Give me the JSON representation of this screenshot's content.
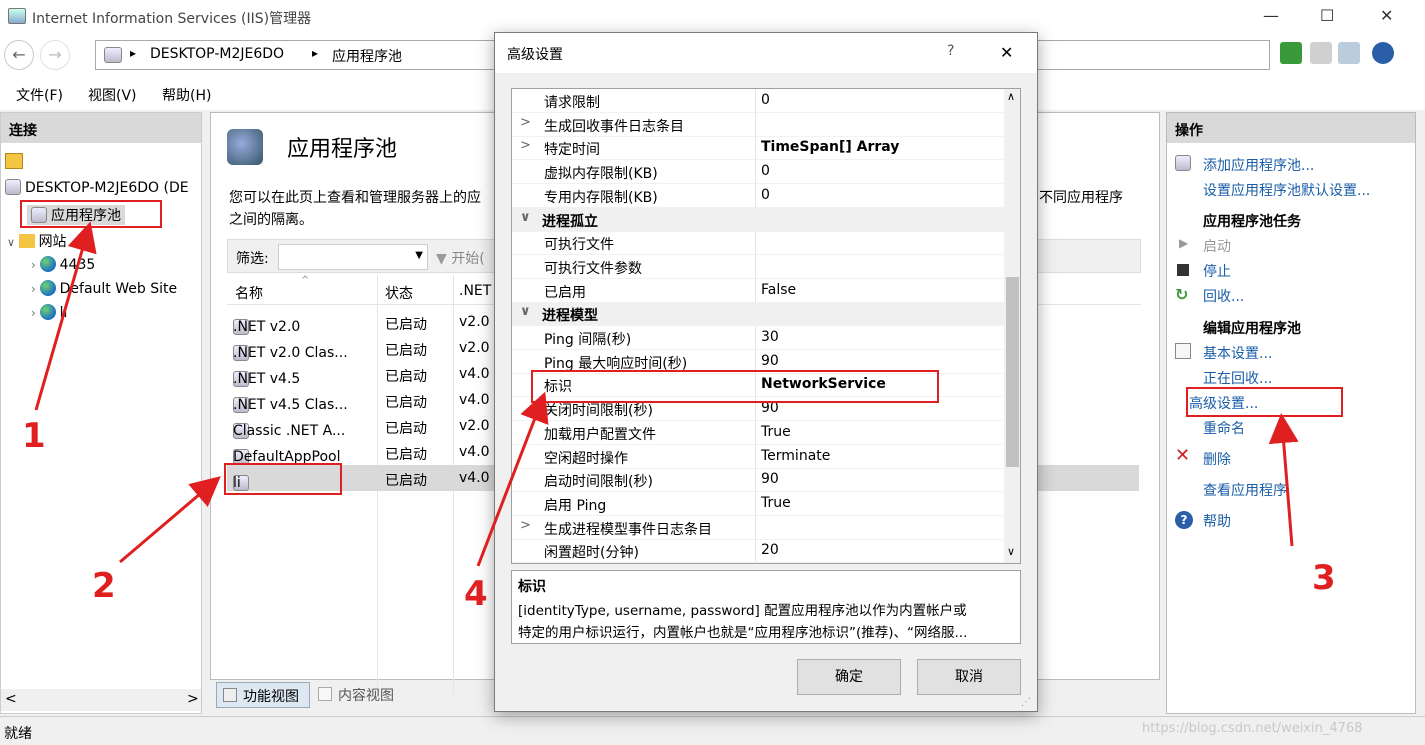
{
  "window": {
    "title": "Internet Information Services (IIS)管理器",
    "minimize": "—",
    "maximize": "☐",
    "close": "✕"
  },
  "address": {
    "back": "←",
    "forward": "→",
    "sep": "▸",
    "path": [
      "DESKTOP-M2JE6DO",
      "应用程序池"
    ]
  },
  "menu": [
    "文件(F)",
    "视图(V)",
    "帮助(H)"
  ],
  "connections": {
    "title": "连接",
    "server": "DESKTOP-M2JE6DO (DE",
    "pools": "应用程序池",
    "sites": "网站",
    "site_items": [
      "4435",
      "Default Web Site",
      "li"
    ],
    "scroll_left": "<",
    "scroll_right": ">"
  },
  "center": {
    "title": "应用程序池",
    "desc1": "您可以在此页上查看和管理服务器上的应",
    "desc1b": "不同应用程序",
    "desc2": "之间的隔离。",
    "filter_label": "筛选:",
    "start_label": "开始(",
    "columns": [
      "名称",
      "状态",
      ".NET"
    ],
    "rows": [
      {
        "name": ".NET v2.0",
        "status": "已启动",
        "net": "v2.0"
      },
      {
        "name": ".NET v2.0 Clas...",
        "status": "已启动",
        "net": "v2.0"
      },
      {
        "name": ".NET v4.5",
        "status": "已启动",
        "net": "v4.0"
      },
      {
        "name": ".NET v4.5 Clas...",
        "status": "已启动",
        "net": "v4.0"
      },
      {
        "name": "Classic .NET A...",
        "status": "已启动",
        "net": "v2.0"
      },
      {
        "name": "DefaultAppPool",
        "status": "已启动",
        "net": "v4.0"
      },
      {
        "name": "li",
        "status": "已启动",
        "net": "v4.0"
      }
    ],
    "tabs": [
      "功能视图",
      "内容视图"
    ]
  },
  "actions": {
    "title": "操作",
    "add": "添加应用程序池...",
    "defaults": "设置应用程序池默认设置...",
    "task_header": "应用程序池任务",
    "start": "启动",
    "stop": "停止",
    "recycle": "回收...",
    "edit_header": "编辑应用程序池",
    "basic": "基本设置...",
    "recycling": "正在回收...",
    "advanced": "高级设置...",
    "rename": "重命名",
    "delete": "删除",
    "view_apps": "查看应用程序",
    "help": "帮助"
  },
  "dialog": {
    "title": "高级设置",
    "help": "?",
    "close": "✕",
    "properties": [
      {
        "type": "prop",
        "key": "请求限制",
        "value": "0",
        "expander": ""
      },
      {
        "type": "prop",
        "key": "生成回收事件日志条目",
        "value": "",
        "expander": ">"
      },
      {
        "type": "prop",
        "key": "特定时间",
        "value": "TimeSpan[] Array",
        "expander": ">",
        "bold": true
      },
      {
        "type": "prop",
        "key": "虚拟内存限制(KB)",
        "value": "0",
        "expander": ""
      },
      {
        "type": "prop",
        "key": "专用内存限制(KB)",
        "value": "0",
        "expander": ""
      },
      {
        "type": "cat",
        "key": "进程孤立",
        "value": "",
        "expander": "∨"
      },
      {
        "type": "prop",
        "key": "可执行文件",
        "value": "",
        "expander": ""
      },
      {
        "type": "prop",
        "key": "可执行文件参数",
        "value": "",
        "expander": ""
      },
      {
        "type": "prop",
        "key": "已启用",
        "value": "False",
        "expander": ""
      },
      {
        "type": "cat",
        "key": "进程模型",
        "value": "",
        "expander": "∨"
      },
      {
        "type": "prop",
        "key": "Ping 间隔(秒)",
        "value": "30",
        "expander": ""
      },
      {
        "type": "prop",
        "key": "Ping 最大响应时间(秒)",
        "value": "90",
        "expander": ""
      },
      {
        "type": "prop",
        "key": "标识",
        "value": "NetworkService",
        "expander": "",
        "bold": true
      },
      {
        "type": "prop",
        "key": "关闭时间限制(秒)",
        "value": "90",
        "expander": ""
      },
      {
        "type": "prop",
        "key": "加载用户配置文件",
        "value": "True",
        "expander": ""
      },
      {
        "type": "prop",
        "key": "空闲超时操作",
        "value": "Terminate",
        "expander": ""
      },
      {
        "type": "prop",
        "key": "启动时间限制(秒)",
        "value": "90",
        "expander": ""
      },
      {
        "type": "prop",
        "key": "启用 Ping",
        "value": "True",
        "expander": ""
      },
      {
        "type": "prop",
        "key": "生成进程模型事件日志条目",
        "value": "",
        "expander": ">"
      },
      {
        "type": "prop",
        "key": "闲置超时(分钟)",
        "value": "20",
        "expander": ""
      }
    ],
    "desc_title": "标识",
    "desc_line1": "[identityType, username, password] 配置应用程序池以作为内置帐户或",
    "desc_line2": "特定的用户标识运行，内置帐户也就是“应用程序池标识”(推荐)、“网络服...",
    "ok": "确定",
    "cancel": "取消"
  },
  "status": {
    "text": "就绪",
    "watermark": "https://blog.csdn.net/weixin_4768"
  },
  "annotations": [
    "1",
    "2",
    "3",
    "4"
  ]
}
